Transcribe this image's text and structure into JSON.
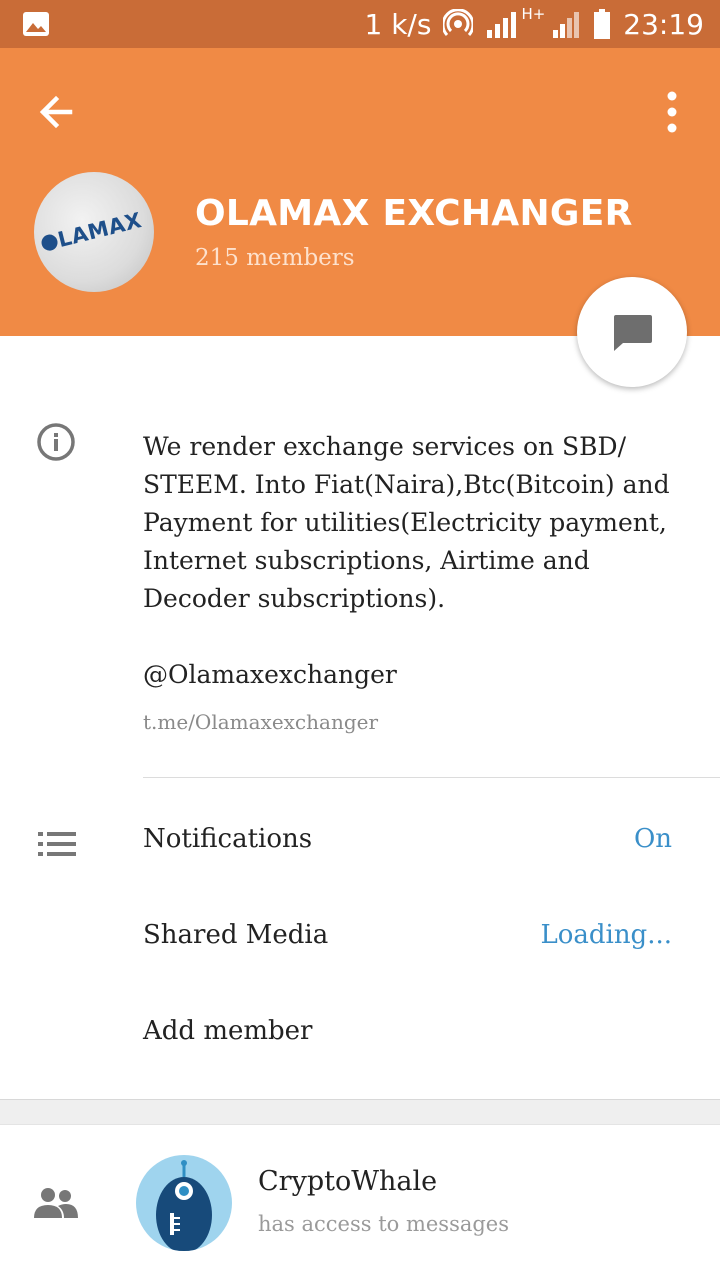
{
  "status_bar": {
    "speed": "1 k/s",
    "network": "H+",
    "time": "23:19"
  },
  "header": {
    "group_name": "OLAMAX EXCHANGER",
    "members_count": "215 members",
    "avatar_logo_text": "LAMAX",
    "accent_color": "#f08a45"
  },
  "info": {
    "description": "We render exchange services on SBD/ STEEM. Into Fiat(Naira),Btc(Bitcoin) and Payment for utilities(Electricity payment, Internet subscriptions, Airtime and Decoder subscriptions).",
    "username": "@Olamaxexchanger",
    "link": "t.me/Olamaxexchanger"
  },
  "settings": {
    "notifications_label": "Notifications",
    "notifications_value": "On",
    "shared_media_label": "Shared Media",
    "shared_media_value": "Loading...",
    "add_member_label": "Add member"
  },
  "members": [
    {
      "name": "CryptoWhale",
      "status": "has access to messages"
    }
  ],
  "icons": [
    "gallery-icon",
    "hotspot-icon",
    "signal-icon",
    "battery-icon",
    "back-arrow-icon",
    "more-vert-icon",
    "chat-icon",
    "info-icon",
    "list-icon",
    "people-icon"
  ]
}
